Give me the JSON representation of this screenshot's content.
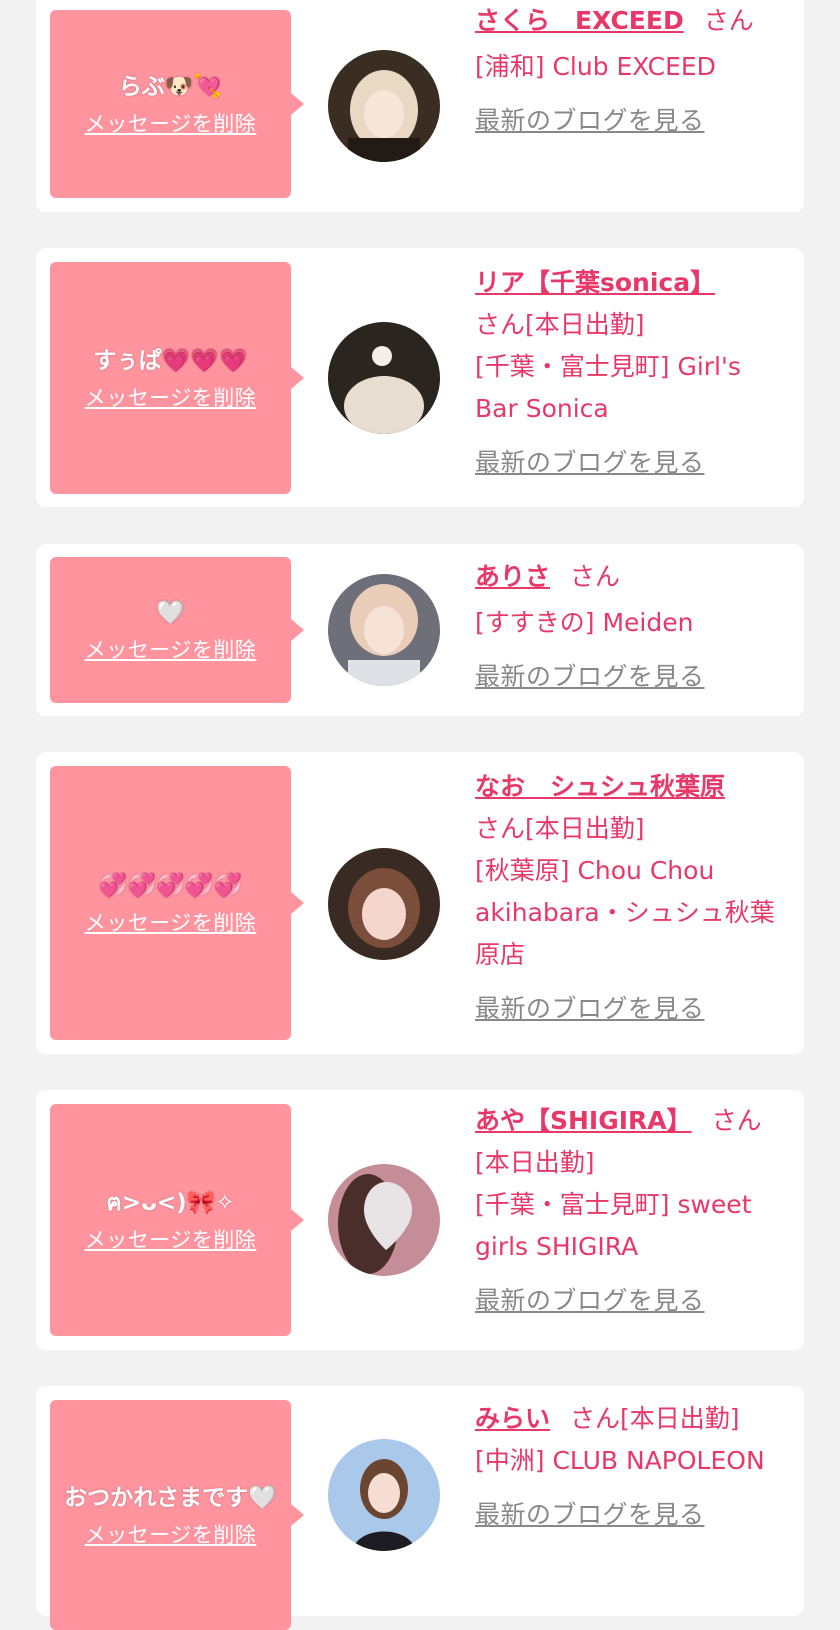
{
  "colors": {
    "accent": "#e8386a",
    "bubble": "#ff949f",
    "link_gray": "#888888",
    "background": "#f2f2f2"
  },
  "delete_label": "メッセージを削除",
  "blog_label": "最新のブログを見る",
  "entries": [
    {
      "message": "らぶ🐶💘",
      "name": "さくら　EXCEED",
      "suffix": "さん",
      "status": "",
      "shop": "[浦和] Club EXCEED"
    },
    {
      "message": "すぅぱ💗💗💗",
      "name": "リア【千葉sonica】",
      "suffix": "さん",
      "status": "[本日出勤]",
      "shop": "[千葉・富士見町] Girl's Bar Sonica"
    },
    {
      "message": "🤍",
      "name": "ありさ",
      "suffix": "さん",
      "status": "",
      "shop": "[すすきの] Meiden"
    },
    {
      "message": "💞💞💞💞💞",
      "name": "なお　シュシュ秋葉原",
      "suffix": "さん",
      "status": "[本日出勤]",
      "shop": "[秋葉原] Chou Chou akihabara・シュシュ秋葉原店"
    },
    {
      "message": "ฅ>ᴗ<)🎀✧",
      "name": "あや【SHIGIRA】",
      "suffix": "さん",
      "status": "[本日出勤]",
      "shop": "[千葉・富士見町] sweet girls SHIGIRA"
    },
    {
      "message": "おつかれさまです🤍",
      "name": "みらい",
      "suffix": "さん",
      "status": "[本日出勤]",
      "shop": "[中洲] CLUB NAPOLEON"
    }
  ]
}
